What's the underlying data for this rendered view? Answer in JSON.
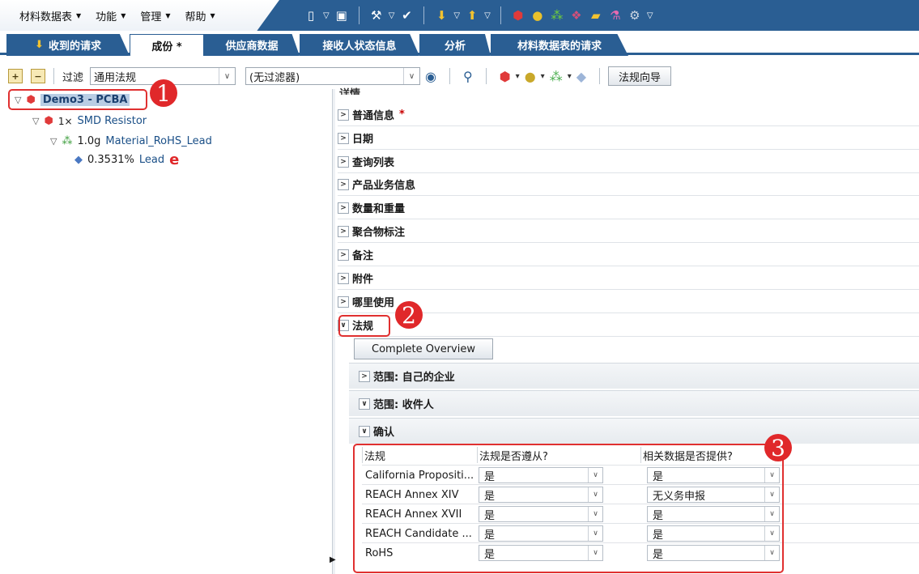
{
  "menubar": {
    "items": [
      {
        "label": "材料数据表"
      },
      {
        "label": "功能"
      },
      {
        "label": "管理"
      },
      {
        "label": "帮助"
      }
    ]
  },
  "tabs": [
    {
      "label": "收到的请求",
      "active": false
    },
    {
      "label": "成份 *",
      "active": true
    },
    {
      "label": "供应商数据",
      "active": false
    },
    {
      "label": "接收人状态信息",
      "active": false
    },
    {
      "label": "分析",
      "active": false
    },
    {
      "label": "材料数据表的请求",
      "active": false
    }
  ],
  "filterbar": {
    "filter_label": "过滤",
    "filter_value": "通用法规",
    "filter2_value": "(无过滤器)",
    "wizard_button": "法规向导"
  },
  "tree": {
    "root": {
      "label": "Demo3 - PCBA"
    },
    "level1": {
      "qty": "1×",
      "label": "SMD Resistor"
    },
    "level2": {
      "qty": "1.0g",
      "label": "Material_RoHS_Lead"
    },
    "level3": {
      "qty": "0.3531%",
      "label": "Lead",
      "marker": "e"
    }
  },
  "details": {
    "title": "详情",
    "sections": [
      {
        "label": "普通信息",
        "required": "*"
      },
      {
        "label": "日期"
      },
      {
        "label": "查询列表"
      },
      {
        "label": "产品业务信息"
      },
      {
        "label": "数量和重量"
      },
      {
        "label": "聚合物标注"
      },
      {
        "label": "备注"
      },
      {
        "label": "附件"
      },
      {
        "label": "哪里使用"
      }
    ],
    "regulations_section": "法规",
    "complete_overview_button": "Complete Overview",
    "subsections": {
      "own_company": "范围: 自己的企业",
      "recipient": "范围: 收件人",
      "confirm": "确认"
    }
  },
  "regulation_table": {
    "headers": [
      "法规",
      "法规是否遵从?",
      "相关数据是否提供?"
    ],
    "rows": [
      {
        "regulation": "California Propositi...",
        "compliant": "是",
        "data_provided": "是"
      },
      {
        "regulation": "REACH Annex XIV",
        "compliant": "是",
        "data_provided": "无义务申报"
      },
      {
        "regulation": "REACH Annex XVII",
        "compliant": "是",
        "data_provided": "是"
      },
      {
        "regulation": "REACH Candidate ...",
        "compliant": "是",
        "data_provided": "是"
      },
      {
        "regulation": "RoHS",
        "compliant": "是",
        "data_provided": "是"
      }
    ]
  },
  "callouts": {
    "one": "1",
    "two": "2",
    "three": "3"
  },
  "colors": {
    "header_blue": "#2a5e93",
    "callout_red": "#e0282a"
  }
}
